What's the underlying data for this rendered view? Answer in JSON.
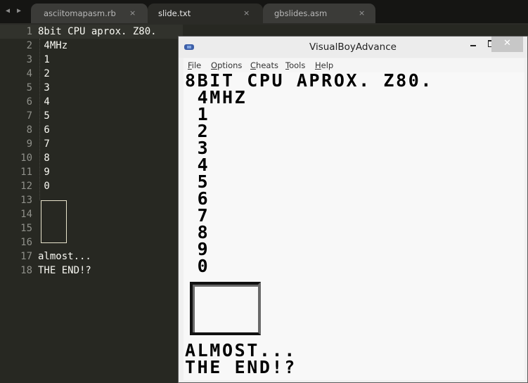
{
  "tabs": [
    {
      "label": "asciitomapasm.rb",
      "active": false
    },
    {
      "label": "slide.txt",
      "active": true
    },
    {
      "label": "gbslides.asm",
      "active": false
    }
  ],
  "icons": {
    "nav_back": "◀",
    "nav_forward": "▶",
    "tab_close": "×",
    "window_close": "✕"
  },
  "editor": {
    "lines": [
      {
        "n": "1",
        "text": "8bit CPU aprox. Z80."
      },
      {
        "n": "2",
        "text": " 4MHz"
      },
      {
        "n": "3",
        "text": " 1"
      },
      {
        "n": "4",
        "text": " 2"
      },
      {
        "n": "5",
        "text": " 3"
      },
      {
        "n": "6",
        "text": " 4"
      },
      {
        "n": "7",
        "text": " 5"
      },
      {
        "n": "8",
        "text": " 6"
      },
      {
        "n": "9",
        "text": " 7"
      },
      {
        "n": "10",
        "text": " 8"
      },
      {
        "n": "11",
        "text": " 9"
      },
      {
        "n": "12",
        "text": " 0"
      },
      {
        "n": "13",
        "text": ""
      },
      {
        "n": "14",
        "text": ""
      },
      {
        "n": "15",
        "text": ""
      },
      {
        "n": "16",
        "text": ""
      },
      {
        "n": "17",
        "text": "almost..."
      },
      {
        "n": "18",
        "text": "THE END!?"
      }
    ]
  },
  "vba": {
    "title": "VisualBoyAdvance",
    "menu": [
      {
        "accel": "F",
        "rest": "ile"
      },
      {
        "accel": "O",
        "rest": "ptions"
      },
      {
        "accel": "C",
        "rest": "heats"
      },
      {
        "accel": "T",
        "rest": "ools"
      },
      {
        "accel": "H",
        "rest": "elp"
      }
    ],
    "screen_lines": [
      "8BIT CPU APROX. Z80.",
      " 4MHZ",
      " 1",
      " 2",
      " 3",
      " 4",
      " 5",
      " 6",
      " 7",
      " 8",
      " 9",
      " 0",
      "ALMOST...",
      "THE END!?"
    ]
  }
}
